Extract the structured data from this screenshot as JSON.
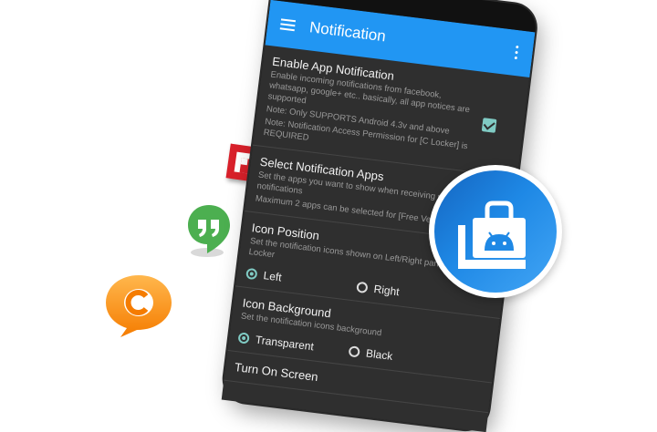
{
  "appbar": {
    "title": "Notification"
  },
  "settings": {
    "enable": {
      "title": "Enable App Notification",
      "desc1": "Enable incoming notifications from facebook, whatsapp, google+ etc.. basically, all app notices are supported",
      "desc2": "Note: Only SUPPORTS Android 4.3v and above",
      "desc3": "Note: Notification Access Permission for [C Locker] is REQUIRED",
      "checked": true
    },
    "select_apps": {
      "title": "Select Notification Apps",
      "desc1": "Set the apps you want to show when receiving new notifications",
      "desc2": "Maximum 2 apps can be selected for [Free Version]"
    },
    "icon_position": {
      "title": "Icon Position",
      "desc": "Set the notification icons shown on Left/Right panel in Locker",
      "options": [
        "Left",
        "Right"
      ],
      "selected": "Left"
    },
    "icon_background": {
      "title": "Icon Background",
      "desc": "Set the notification icons background",
      "options": [
        "Transparent",
        "Black"
      ],
      "selected": "Transparent"
    },
    "turn_on": {
      "title": "Turn On Screen"
    }
  },
  "colors": {
    "appbar": "#2196f3",
    "accent": "#80cbc4",
    "screen_bg": "#2f2f2f",
    "badge": "#1e88e5"
  },
  "icons": [
    "flipboard-icon",
    "hangouts-icon",
    "chaton-icon",
    "android-bag-icon",
    "login-icon",
    "hamburger-icon",
    "overflow-menu-icon"
  ]
}
